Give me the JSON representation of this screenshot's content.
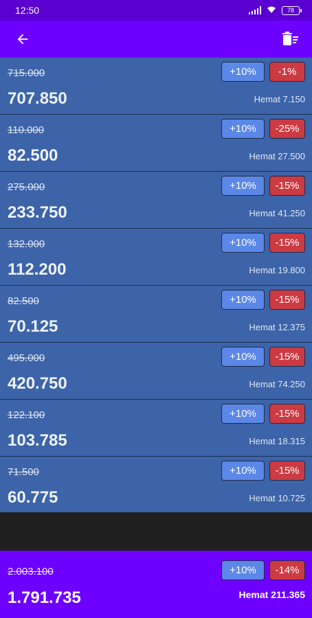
{
  "status_bar": {
    "time": "12:50",
    "battery": "78"
  },
  "icons": {
    "back": "arrow-left-icon",
    "clear": "clear-list-icon"
  },
  "colors": {
    "accent": "#6d00ff",
    "row_bg": "#3d64a8",
    "plus_button": "#5b87e6",
    "minus_button": "#cc3a42"
  },
  "items": [
    {
      "original": "715.000",
      "final": "707.850",
      "saving": "Hemat 7.150",
      "plus_label": "+10%",
      "discount_label": "-1%"
    },
    {
      "original": "110.000",
      "final": "82.500",
      "saving": "Hemat 27.500",
      "plus_label": "+10%",
      "discount_label": "-25%"
    },
    {
      "original": "275.000",
      "final": "233.750",
      "saving": "Hemat 41.250",
      "plus_label": "+10%",
      "discount_label": "-15%"
    },
    {
      "original": "132.000",
      "final": "112.200",
      "saving": "Hemat 19.800",
      "plus_label": "+10%",
      "discount_label": "-15%"
    },
    {
      "original": "82.500",
      "final": "70.125",
      "saving": "Hemat 12.375",
      "plus_label": "+10%",
      "discount_label": "-15%"
    },
    {
      "original": "495.000",
      "final": "420.750",
      "saving": "Hemat 74.250",
      "plus_label": "+10%",
      "discount_label": "-15%"
    },
    {
      "original": "122.100",
      "final": "103.785",
      "saving": "Hemat 18.315",
      "plus_label": "+10%",
      "discount_label": "-15%"
    },
    {
      "original": "71.500",
      "final": "60.775",
      "saving": "Hemat 10.725",
      "plus_label": "+10%",
      "discount_label": "-15%"
    }
  ],
  "total": {
    "original": "2.003.100",
    "final": "1.791.735",
    "saving": "Hemat 211.365",
    "plus_label": "+10%",
    "discount_label": "-14%"
  }
}
